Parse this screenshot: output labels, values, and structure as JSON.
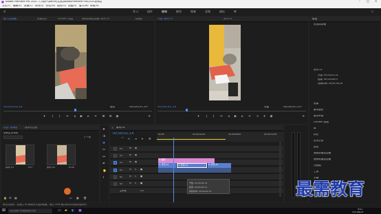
{
  "window_title": "Adobe Premiere Pro 2020 - C:\\用户\\Admin\\文档\\Adobe\\Premiere Pro\\14.0\\未命名",
  "menu": [
    "文件(F)",
    "编辑(E)",
    "剪辑(C)",
    "序列(S)",
    "标记(M)",
    "图形(G)",
    "视图(V)",
    "窗口(W)",
    "帮助(H)"
  ],
  "workspaces": [
    "学习",
    "组件",
    "编辑",
    "颜色",
    "效果",
    "音频",
    "图形",
    "库"
  ],
  "source_monitor": {
    "tabs": [
      "源: (无剪辑)",
      "效果控件",
      "Lumetri 范围",
      "音频剪辑混合器: 序列 01",
      "元数据"
    ],
    "timecode_left": "00;00;04;16",
    "fit": "适合",
    "timecode_right": "00;00;07;07"
  },
  "program_monitor": {
    "tabs": [
      "节目: 序列 01",
      "序列 01"
    ],
    "timecode_left": "00;00;01;14",
    "fit": "完整",
    "timecode_right": "00;00;07;07"
  },
  "right_panel": {
    "title": "信息",
    "selected_label": "未选择剪辑",
    "file_label": "序列 01",
    "info_rows": [
      "开始: 00;00;01;14",
      "结束: 00;00;06;07",
      "持续时间: 00;00;04;16"
    ],
    "sections": [
      "效果",
      "基本图形",
      "基本声音",
      "Lumetri 颜色",
      "库",
      "标记",
      "历史记录",
      "信息",
      "音频剪辑混合器",
      "音频轨道混合器",
      "元数据",
      "工具",
      "字幕",
      "项目",
      "捕捉"
    ]
  },
  "project_panel": {
    "tabs": [
      "项目: 未命名",
      "媒体浏览器"
    ],
    "path": "未命名.prproj",
    "count": "2 个项",
    "items": [
      {
        "name": "序列 01",
        "duration": "7;07"
      },
      {
        "name": "序列 02",
        "duration": "4;16"
      }
    ]
  },
  "sequence_panel": {
    "tab": "序列 01",
    "timecode": "00;00;01;14",
    "ruler": [
      "00;00",
      "00;00;04;00",
      "00;00;08;00",
      "00;00;12;00"
    ],
    "tracks": [
      "V3",
      "V2",
      "V1",
      "A1",
      "A2",
      "A3",
      "主声道"
    ],
    "master_value": "0.0",
    "clips": [
      {
        "label": "fx 图形"
      },
      {
        "label": "fx 序列 01"
      },
      {
        "label": "fx 序列 01"
      },
      {
        "label": "fx 序列 01"
      }
    ],
    "tooltip": [
      "开始: 00;00;02;19",
      "结束: 00;00;04;11",
      "持续时间: 00;00;01;23"
    ]
  },
  "status_text": "单击以选择，或按住 Alt 键单击以选择轨道。按住 Shift 键并单击以添加到选择项",
  "watermark": "最需教育",
  "taskbar": {
    "search_placeholder": "在这里输入你要搜索的内容",
    "time": "9:01",
    "date": "2021/8/24"
  },
  "colors": {
    "accent": "#4f8fe8",
    "clip_pink": "#d98ad3",
    "clip_blue": "#5a7fd0",
    "playhead": "#4f8fe8",
    "workarea": "#e6d33c"
  }
}
